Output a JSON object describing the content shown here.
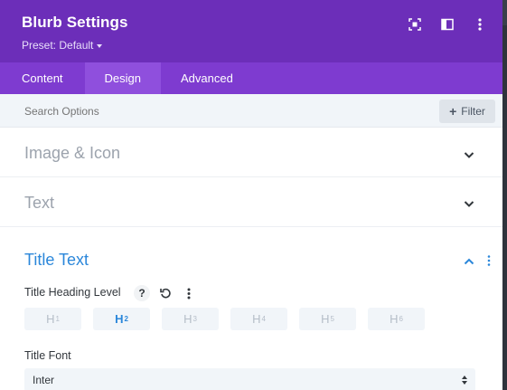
{
  "header": {
    "title": "Blurb Settings",
    "preset": "Preset: Default",
    "bg_color": "#6c2eb9",
    "icons": [
      "focus-icon",
      "split-view-icon",
      "more-vertical-icon"
    ]
  },
  "tabs": [
    {
      "label": "Content",
      "active": false
    },
    {
      "label": "Design",
      "active": true
    },
    {
      "label": "Advanced",
      "active": false
    }
  ],
  "search": {
    "placeholder": "Search Options",
    "filter_label": "Filter"
  },
  "sections": [
    {
      "title": "Image & Icon",
      "expanded": false
    },
    {
      "title": "Text",
      "expanded": false
    }
  ],
  "open_section": {
    "title": "Title Text",
    "expanded": true,
    "accent_color": "#2b87da",
    "heading_level": {
      "label": "Title Heading Level",
      "icons": [
        "help-icon",
        "reset-icon",
        "more-vertical-icon"
      ],
      "options": [
        {
          "main": "H",
          "sub": "1",
          "active": false
        },
        {
          "main": "H",
          "sub": "2",
          "active": true
        },
        {
          "main": "H",
          "sub": "3",
          "active": false
        },
        {
          "main": "H",
          "sub": "4",
          "active": false
        },
        {
          "main": "H",
          "sub": "5",
          "active": false
        },
        {
          "main": "H",
          "sub": "6",
          "active": false
        }
      ]
    },
    "font": {
      "label": "Title Font",
      "value": "Inter"
    }
  }
}
